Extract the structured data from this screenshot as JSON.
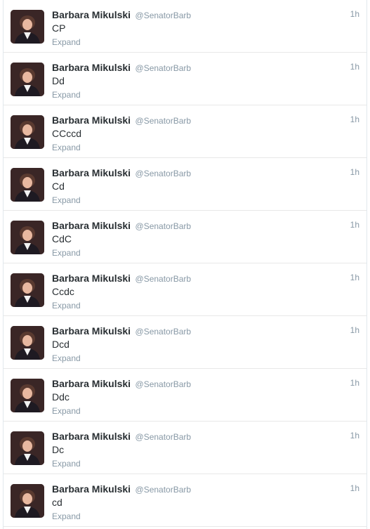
{
  "tweets": [
    {
      "name": "Barbara Mikulski",
      "handle": "@SenatorBarb",
      "time": "1h",
      "text": "CP",
      "action": "Expand"
    },
    {
      "name": "Barbara Mikulski",
      "handle": "@SenatorBarb",
      "time": "1h",
      "text": "Dd",
      "action": "Expand"
    },
    {
      "name": "Barbara Mikulski",
      "handle": "@SenatorBarb",
      "time": "1h",
      "text": "CCccd",
      "action": "Expand"
    },
    {
      "name": "Barbara Mikulski",
      "handle": "@SenatorBarb",
      "time": "1h",
      "text": "Cd",
      "action": "Expand"
    },
    {
      "name": "Barbara Mikulski",
      "handle": "@SenatorBarb",
      "time": "1h",
      "text": "CdC",
      "action": "Expand"
    },
    {
      "name": "Barbara Mikulski",
      "handle": "@SenatorBarb",
      "time": "1h",
      "text": "Ccdc",
      "action": "Expand"
    },
    {
      "name": "Barbara Mikulski",
      "handle": "@SenatorBarb",
      "time": "1h",
      "text": "Dcd",
      "action": "Expand"
    },
    {
      "name": "Barbara Mikulski",
      "handle": "@SenatorBarb",
      "time": "1h",
      "text": "Ddc",
      "action": "Expand"
    },
    {
      "name": "Barbara Mikulski",
      "handle": "@SenatorBarb",
      "time": "1h",
      "text": "Dc",
      "action": "Expand"
    },
    {
      "name": "Barbara Mikulski",
      "handle": "@SenatorBarb",
      "time": "1h",
      "text": "cd",
      "action": "Expand"
    }
  ],
  "colors": {
    "name": "#292f33",
    "meta": "#8899a6",
    "divider": "#e8e8e8"
  },
  "icons": {
    "avatar": "profile-photo-icon"
  }
}
